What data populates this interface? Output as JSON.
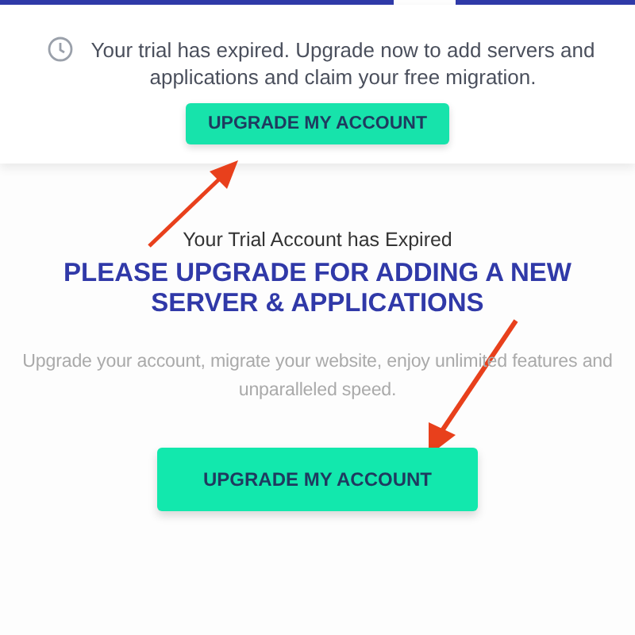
{
  "banner": {
    "message": "Your trial has expired. Upgrade now to add servers and applications and claim your free migration.",
    "button": "UPGRADE MY ACCOUNT"
  },
  "main": {
    "subtitle": "Your Trial Account has Expired",
    "heading": "PLEASE UPGRADE FOR ADDING A NEW SERVER & APPLICATIONS",
    "description": "Upgrade your account, migrate your website, enjoy unlimited features and unparalleled speed.",
    "button": "UPGRADE MY ACCOUNT"
  }
}
